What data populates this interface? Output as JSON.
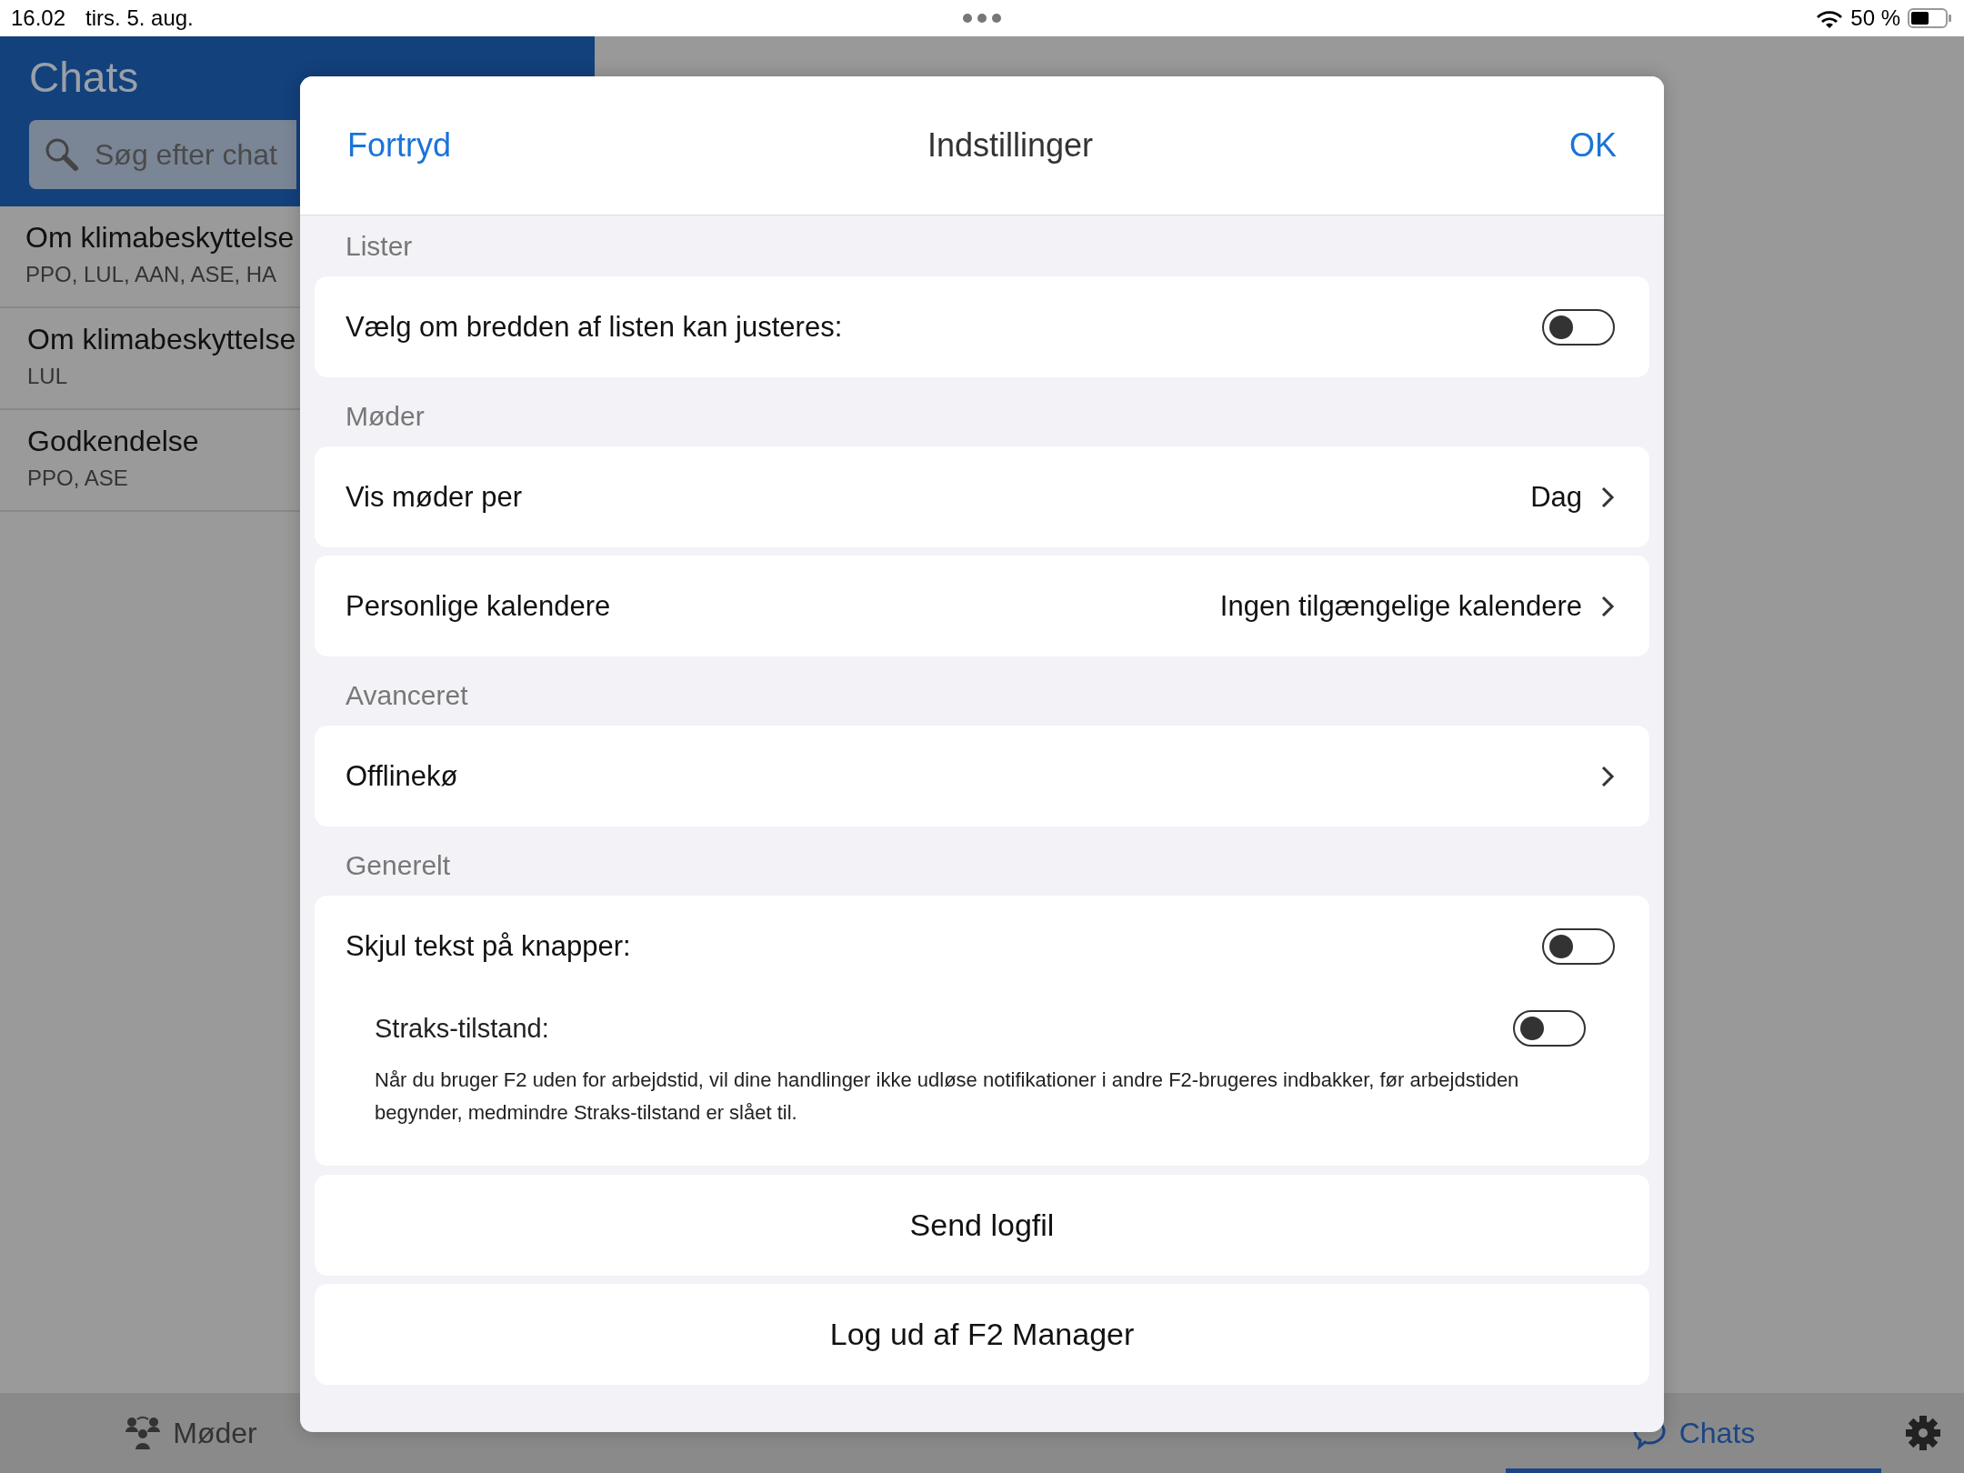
{
  "status_bar": {
    "time": "16.02",
    "date": "tirs. 5. aug.",
    "battery": "50 %"
  },
  "sidebar": {
    "title": "Chats",
    "search": {
      "placeholder": "Søg efter chat"
    },
    "chats": [
      {
        "title": "Om klimabeskyttelse",
        "members": "PPO, LUL, AAN, ASE, HA"
      },
      {
        "title": "Om klimabeskyttelse",
        "members": "LUL"
      },
      {
        "title": "Godkendelse",
        "members": "PPO, ASE"
      }
    ]
  },
  "tab_bar": {
    "items": [
      {
        "kind": "meetings",
        "label": "Møder",
        "selected": false
      },
      {
        "kind": "chats",
        "label": "Chats",
        "selected": true
      }
    ]
  },
  "dialog": {
    "cancel": "Fortryd",
    "title": "Indstillinger",
    "confirm": "OK",
    "sections": [
      {
        "title": "Lister",
        "cards": [
          {
            "rows": [
              {
                "kind": "toggle",
                "label": "Vælg om bredden af listen kan justeres:",
                "on": false
              }
            ]
          }
        ]
      },
      {
        "title": "Møder",
        "cards": [
          {
            "rows": [
              {
                "kind": "link",
                "label": "Vis møder per",
                "value": "Dag"
              }
            ]
          },
          {
            "rows": [
              {
                "kind": "link",
                "label": "Personlige kalendere",
                "value": "Ingen tilgængelige kalendere"
              }
            ]
          }
        ]
      },
      {
        "title": "Avanceret",
        "cards": [
          {
            "rows": [
              {
                "kind": "link",
                "label": "Offlinekø"
              }
            ]
          }
        ]
      },
      {
        "title": "Generelt",
        "cards": [
          {
            "rows": [
              {
                "kind": "toggle",
                "label": "Skjul tekst på knapper:",
                "on": false
              },
              {
                "kind": "subtoggle",
                "label": "Straks-tilstand:",
                "on": false,
                "description": "Når du bruger F2 uden for arbejdstid, vil dine handlinger ikke udløse notifikationer i andre F2-brugeres indbakker, før arbejdstiden begynder, medmindre Straks-tilstand er slået til."
              }
            ]
          }
        ]
      }
    ],
    "actions": [
      "Send logfil",
      "Log ud af F2 Manager"
    ]
  }
}
